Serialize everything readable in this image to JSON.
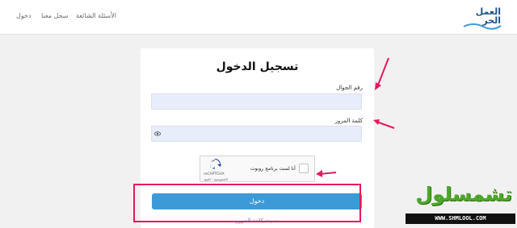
{
  "header": {
    "nav": {
      "login": "دخول",
      "register": "سجل معنا",
      "faq": "الأسئلة الشائعة"
    },
    "logo_text": [
      "العمل",
      "الحر"
    ]
  },
  "form": {
    "title": "تسجيل الدخول",
    "phone_label": "رقم الجوال",
    "phone_value": "",
    "password_label": "كلمة المرور",
    "password_value": "",
    "captcha": {
      "label": "أنا لست برنامج روبوت",
      "brand": "reCAPTCHA",
      "terms": "الخصوصية - البنود",
      "checked": false
    },
    "submit_label": "دخول",
    "forgot_label": "نسيت كلمة المرور"
  },
  "colors": {
    "accent": "#3d9ad6",
    "annotation": "#e6185c",
    "input_bg": "#e8edfb"
  },
  "icons": [
    "eye-icon",
    "recaptcha-icon"
  ],
  "watermark": {
    "title": "تشمسلول",
    "url": "WWW.SHMLOOL.COM"
  }
}
